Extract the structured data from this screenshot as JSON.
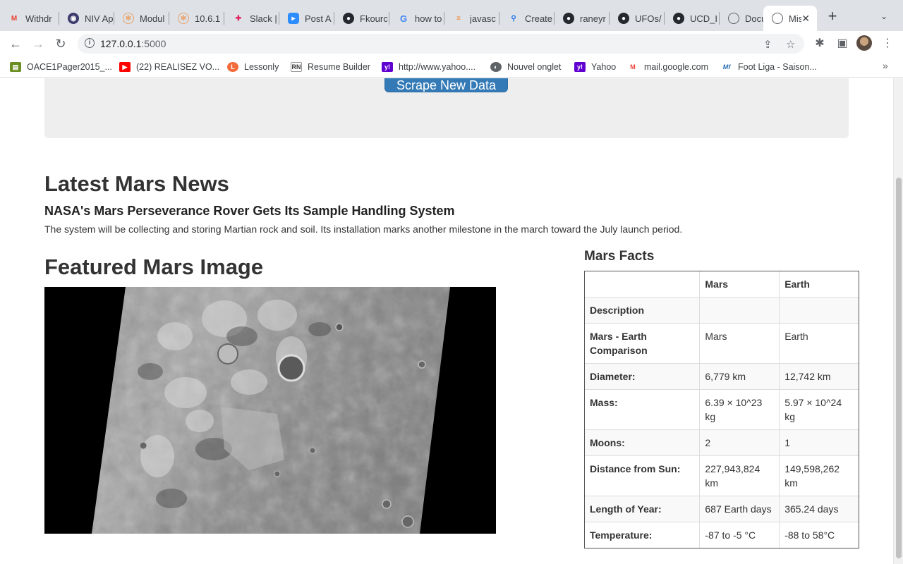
{
  "browser": {
    "tabs": [
      {
        "label": "Withdr",
        "icon": "gmail-icon"
      },
      {
        "label": "NIV Ap",
        "icon": "state-dept-seal-icon"
      },
      {
        "label": "Modul",
        "icon": "bootcamp-icon"
      },
      {
        "label": "10.6.1",
        "icon": "bootcamp-icon"
      },
      {
        "label": "Slack |",
        "icon": "slack-icon"
      },
      {
        "label": "Post A",
        "icon": "zoom-icon"
      },
      {
        "label": "Fkourc",
        "icon": "github-icon"
      },
      {
        "label": "how to",
        "icon": "google-icon"
      },
      {
        "label": "javasc",
        "icon": "stackoverflow-icon"
      },
      {
        "label": "Create",
        "icon": "search-icon"
      },
      {
        "label": "raneyr",
        "icon": "github-icon"
      },
      {
        "label": "UFOs/",
        "icon": "github-icon"
      },
      {
        "label": "UCD_I",
        "icon": "github-icon"
      },
      {
        "label": "Docun",
        "icon": "globe-icon"
      },
      {
        "label": "Mis",
        "icon": "globe-icon",
        "active": true
      }
    ],
    "url_host": "127.0.0.1",
    "url_port": ":5000",
    "bookmarks": [
      {
        "label": "OACE1Pager2015_...",
        "icon": "file-icon"
      },
      {
        "label": "(22) REALISEZ VO...",
        "icon": "youtube-icon"
      },
      {
        "label": "Lessonly",
        "icon": "lessonly-icon"
      },
      {
        "label": "Resume Builder",
        "icon": "rn-icon"
      },
      {
        "label": "http://www.yahoo....",
        "icon": "yahoo-icon"
      },
      {
        "label": "Nouvel onglet",
        "icon": "globe-icon"
      },
      {
        "label": "Yahoo",
        "icon": "yahoo-icon"
      },
      {
        "label": "mail.google.com",
        "icon": "gmail-icon"
      },
      {
        "label": "Foot Liga - Saison...",
        "icon": "mf-icon"
      }
    ]
  },
  "page": {
    "scrape_button": "Scrape New Data",
    "news_heading": "Latest Mars News",
    "news_title": "NASA's Mars Perseverance Rover Gets Its Sample Handling System",
    "news_paragraph": "The system will be collecting and storing Martian rock and soil. Its installation marks another milestone in the march toward the July launch period.",
    "image_heading": "Featured Mars Image",
    "facts_heading": "Mars Facts",
    "facts_table": {
      "header": [
        "",
        "Mars",
        "Earth"
      ],
      "rows": [
        [
          "Description",
          "",
          ""
        ],
        [
          "Mars - Earth Comparison",
          "Mars",
          "Earth"
        ],
        [
          "Diameter:",
          "6,779 km",
          "12,742 km"
        ],
        [
          "Mass:",
          "6.39 × 10^23 kg",
          "5.97 × 10^24 kg"
        ],
        [
          "Moons:",
          "2",
          "1"
        ],
        [
          "Distance from Sun:",
          "227,943,824 km",
          "149,598,262 km"
        ],
        [
          "Length of Year:",
          "687 Earth days",
          "365.24 days"
        ],
        [
          "Temperature:",
          "-87 to -5 °C",
          "-88 to 58°C"
        ]
      ]
    }
  }
}
